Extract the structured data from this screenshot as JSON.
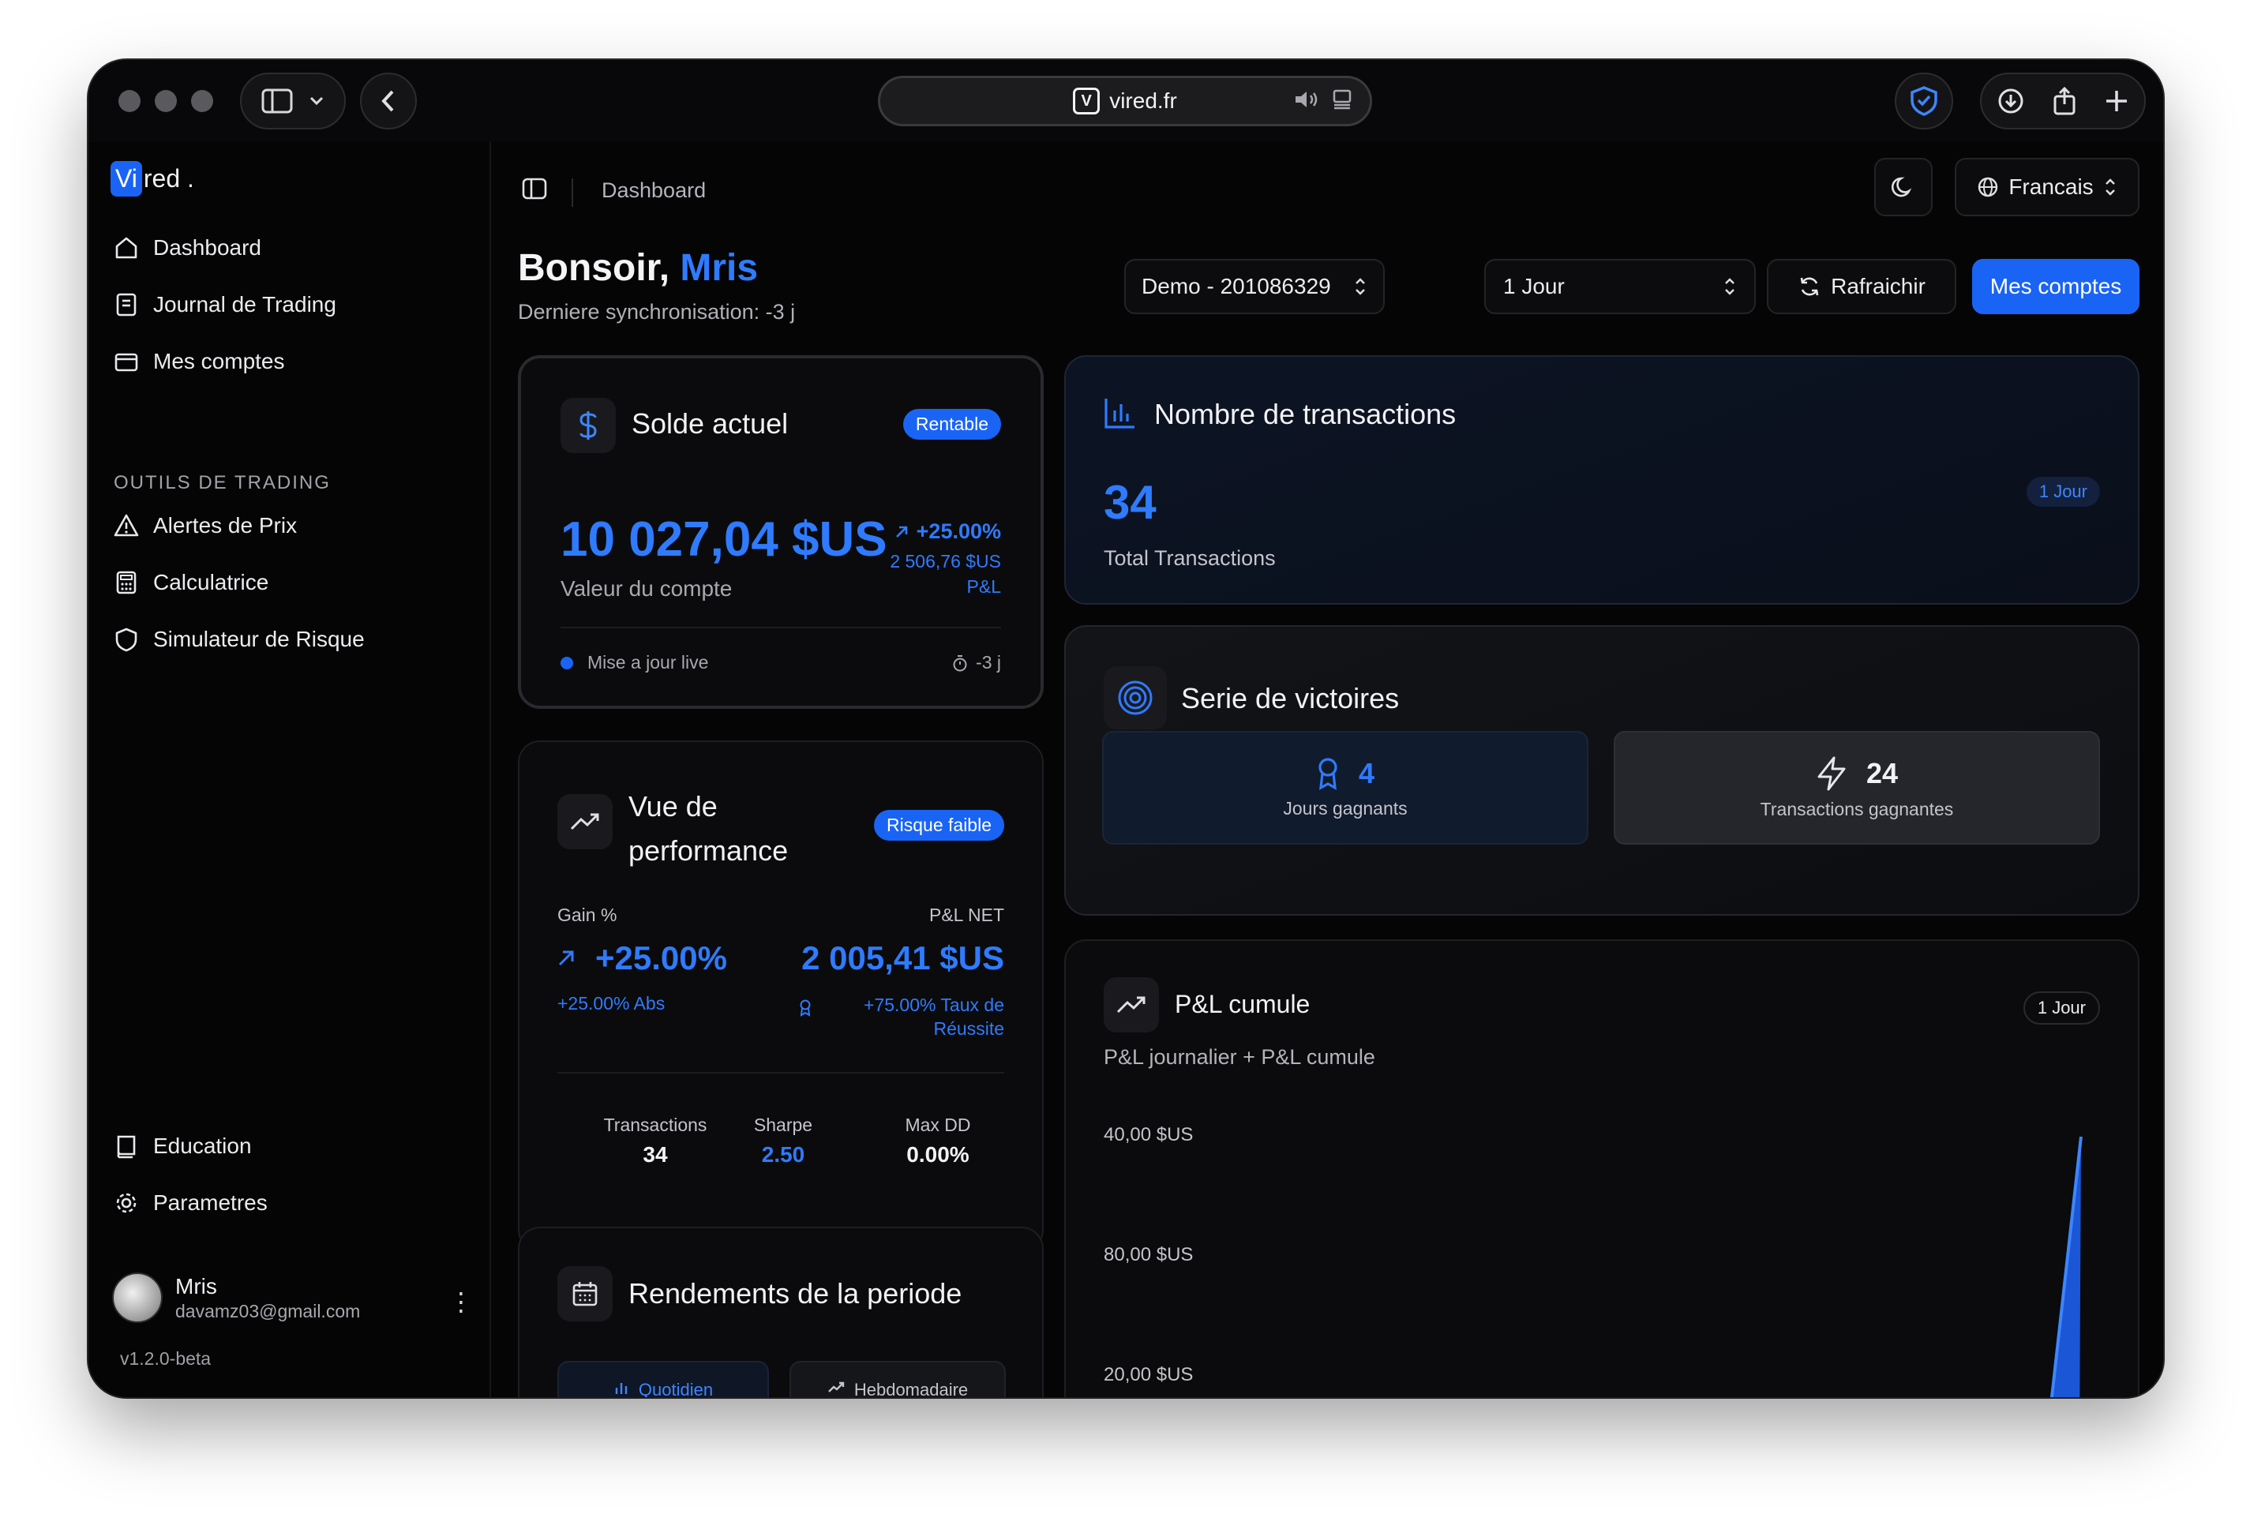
{
  "browser": {
    "url": "vired.fr"
  },
  "sidebar": {
    "logo_prefix": "Vi",
    "logo_suffix": "red .",
    "nav": [
      "Dashboard",
      "Journal de Trading",
      "Mes comptes"
    ],
    "section_title": "OUTILS DE TRADING",
    "tools": [
      "Alertes de Prix",
      "Calculatrice",
      "Simulateur de Risque"
    ],
    "bottom": [
      "Education",
      "Parametres"
    ],
    "user": {
      "name": "Mris",
      "email": "davamz03@gmail.com"
    },
    "version": "v1.2.0-beta"
  },
  "topbar": {
    "breadcrumb": "Dashboard",
    "language": "Francais"
  },
  "header": {
    "greeting": "Bonsoir,",
    "name": "Mris",
    "sync": "Derniere synchronisation: -3 j",
    "account_select": "Demo - 201086329",
    "period_select": "1 Jour",
    "refresh_label": "Rafraichir",
    "accounts_label": "Mes comptes"
  },
  "balance": {
    "title": "Solde actuel",
    "badge": "Rentable",
    "value": "10 027,04 $US",
    "change_pct": "+25.00%",
    "change_abs": "2 506,76 $US",
    "change_label": "P&L",
    "caption": "Valeur du compte",
    "live": "Mise a jour live",
    "age": "-3 j"
  },
  "performance": {
    "title_line1": "Vue de",
    "title_line2": "performance",
    "badge": "Risque faible",
    "gain_label": "Gain %",
    "gain_value": "+25.00%",
    "gain_sub": "+25.00% Abs",
    "pnl_label": "P&L NET",
    "pnl_value": "2 005,41 $US",
    "pnl_sub_line1": "+75.00% Taux de",
    "pnl_sub_line2": "Réussite",
    "stats": [
      {
        "label": "Transactions",
        "value": "34"
      },
      {
        "label": "Sharpe",
        "value": "2.50"
      },
      {
        "label": "Max DD",
        "value": "0.00%"
      }
    ]
  },
  "returns": {
    "title": "Rendements de la periode",
    "tabs": [
      "Quotidien",
      "Hebdomadaire"
    ]
  },
  "transactions": {
    "title": "Nombre de transactions",
    "value": "34",
    "caption": "Total Transactions",
    "badge": "1 Jour"
  },
  "streak": {
    "title": "Serie de victoires",
    "days_value": "4",
    "days_label": "Jours gagnants",
    "trades_value": "24",
    "trades_label": "Transactions gagnantes"
  },
  "pnl_chart": {
    "title": "P&L cumule",
    "subtitle": "P&L journalier + P&L cumule",
    "badge": "1 Jour",
    "y_ticks": [
      "40,00 $US",
      "80,00 $US",
      "20,00 $US"
    ]
  },
  "colors": {
    "accent": "#1a64f5",
    "accent_text": "#2f7bff",
    "background": "#050506"
  }
}
